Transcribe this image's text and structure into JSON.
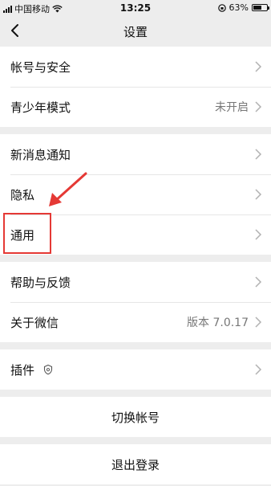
{
  "status_bar": {
    "carrier": "中国移动",
    "time": "13:25",
    "battery": "63%",
    "battery_level": 0.63
  },
  "nav": {
    "title": "设置"
  },
  "groups": {
    "account": [
      {
        "label": "帐号与安全"
      },
      {
        "label": "青少年模式",
        "value": "未开启"
      }
    ],
    "notify": [
      {
        "label": "新消息通知"
      },
      {
        "label": "隐私"
      },
      {
        "label": "通用"
      }
    ],
    "help": [
      {
        "label": "帮助与反馈"
      },
      {
        "label": "关于微信",
        "value": "版本 7.0.17"
      }
    ],
    "plugins": [
      {
        "label": "插件"
      }
    ],
    "switch": {
      "label": "切换帐号"
    },
    "logout": {
      "label": "退出登录"
    }
  },
  "colors": {
    "annotation": "#e53935",
    "background": "#ededed",
    "secondary_text": "#777777"
  }
}
